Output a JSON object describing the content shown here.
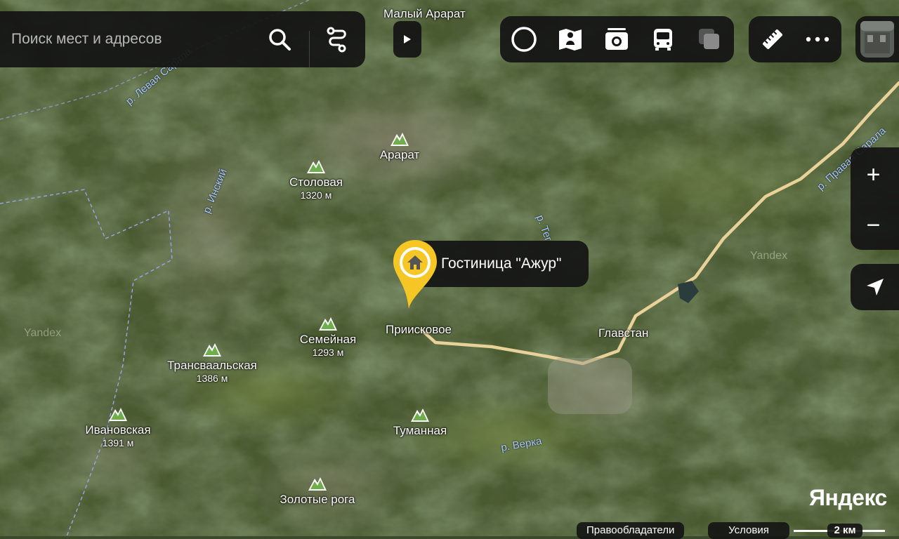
{
  "search": {
    "placeholder": "Поиск мест и адресов"
  },
  "colors": {
    "panel": "#141414",
    "accent": "#f6c624",
    "road": "#e9d29a",
    "river_label": "#a9c8ff",
    "boundary": "#9aa6e8",
    "peak_icon": "#6fae4c"
  },
  "icons": {
    "search": "search-icon",
    "route": "route-icon",
    "collapse": "play-triangle-icon",
    "layers": [
      "circle-layer-icon",
      "map-book-icon",
      "camera-icon",
      "bus-icon",
      "overlay-squares-icon"
    ],
    "tools": [
      "ruler-icon",
      "more-dots-icon"
    ],
    "panorama": "panorama-thumbnail-icon",
    "locate": "navigation-arrow-icon"
  },
  "zoom": {
    "in_label": "+",
    "out_label": "−"
  },
  "poi": {
    "name": "Гостиница \"Ажур\"",
    "icon": "house-icon"
  },
  "peaks": [
    {
      "name": "Столовая",
      "elevation": "1320 м"
    },
    {
      "name": "Арарат",
      "elevation": ""
    },
    {
      "name": "Семейная",
      "elevation": "1293 м"
    },
    {
      "name": "Трансваальская",
      "elevation": "1386 м"
    },
    {
      "name": "Ивановская",
      "elevation": "1391 м"
    },
    {
      "name": "Туманная",
      "elevation": ""
    },
    {
      "name": "Золотые рога",
      "elevation": ""
    }
  ],
  "places": {
    "top": "Малый Арарат",
    "priiskovoe": "Приисковое",
    "glavstan": "Главстан"
  },
  "rivers": {
    "levaya_sarala": "р. Левая Сарала",
    "inskiy": "р. Инский",
    "pravaya_sarala": "р. Правая Сарала",
    "verka": "р. Верка",
    "teg": "р. Тег"
  },
  "watermarks": {
    "left": "Yandex",
    "right": "Yandex"
  },
  "brand": "Яндекс",
  "footer": {
    "copyright": "Правообладатели",
    "terms": "Условия",
    "scale": "2 км"
  }
}
